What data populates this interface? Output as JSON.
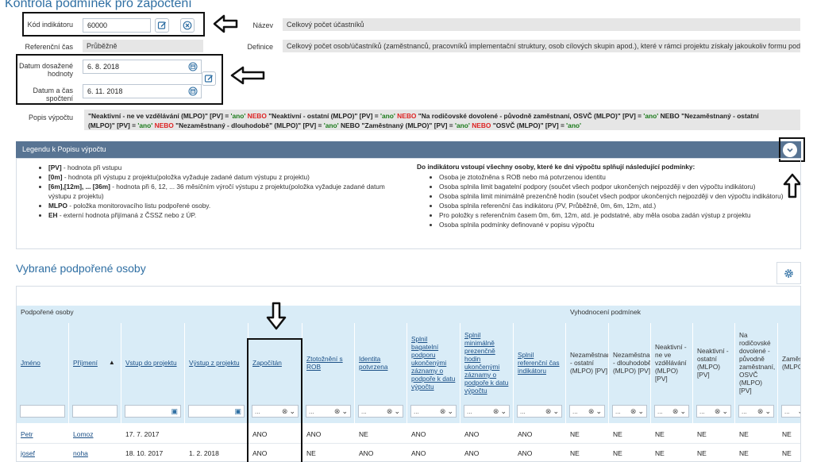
{
  "page_title": "Kontrola podmínek pro započtení",
  "kod_indikatoru": {
    "label": "Kód indikátoru",
    "value": "60000"
  },
  "nazev": {
    "label": "Název",
    "value": "Celkový počet účastníků"
  },
  "referencni_cas": {
    "label": "Referenční čas",
    "value": "Průběžně"
  },
  "definice": {
    "label": "Definice",
    "value": "Celkový počet osob/účastníků (zaměstnanců, pracovníků implementační struktury, osob cílových skupin apod.), které v rámci projektu získaly jakoukoliv formu podpo"
  },
  "datum_dosazene": {
    "label_line1": "Datum dosažené",
    "label_line2": "hodnoty",
    "value": "6. 8. 2018"
  },
  "datum_spocteni": {
    "label_line1": "Datum a čas",
    "label_line2": "spočtení",
    "value": "6. 11. 2018"
  },
  "popis_vypoctu": {
    "label": "Popis výpočtu",
    "p1": "\"Neaktivní - ne ve vzdělávání (MLPO)\" [PV] = ",
    "q": "'ano'",
    "or": " NEBO ",
    "p2": "\"Neaktivní - ostatní (MLPO)\" [PV] = ",
    "p3": "\"Na rodičovské dovolené - původně zaměstnaní, OSVČ (MLPO)\" [PV] = ",
    "p3b": " NEBO ",
    "p4": "\"Nezaměstnaný - ostatní",
    "p5": "(MLPO)\" [PV] = ",
    "p6": "\"Nezaměstnaný - dlouhodobě\" (MLPO)\" [PV] = ",
    "p6b": " NEBO ",
    "p7": "\"Zaměstnaný (MLPO)\" [PV] = ",
    "p8": "\"OSVČ (MLPO)\" [PV] = "
  },
  "legend": {
    "title": "Legendu k Popisu výpočtu",
    "left": [
      {
        "b": "[PV]",
        "t": " - hodnota při vstupu"
      },
      {
        "b": "[0m]",
        "t": " - hodnota při výstupu z projektu(položka vyžaduje zadané datum výstupu z projektu)"
      },
      {
        "b": "[6m],[12m], ... [36m]",
        "t": " - hodnota při 6, 12, ... 36 měsíčním výročí výstupu z projektu(položka vyžaduje zadané datum výstupu z projektu)"
      },
      {
        "b": "MLPO",
        "t": " - položka monitorovacího listu podpořené osoby."
      },
      {
        "b": "EH",
        "t": " - externí hodnota přijímaná z ČSSZ nebo z ÚP."
      }
    ],
    "right_title": "Do indikátoru vstoupí všechny osoby, které ke dni výpočtu splňují následující podmínky:",
    "right": [
      "Osoba je ztotožněna s ROB nebo má potvrzenou identitu",
      "Osoba splnila limit bagatelní podpory (součet všech podpor ukončených nejpozději v den výpočtu indikátoru)",
      "Osoba splnila limit minimálně prezenčně hodin (součet všech podpor ukončených nejpozději v den výpočtu indikátoru)",
      "Osoba splnila referenční čas indikátoru (PV, Průběžně, 0m, 6m, 12m, atd.)",
      "Pro položky s referenčním časem 0m, 6m, 12m, atd. je podstatné, aby měla osoba zadán výstup z projektu",
      "Osoba splnila podmínky definované v popisu výpočtu"
    ]
  },
  "section_title": "Vybrané podpořené osoby",
  "table": {
    "group_left": "Podpořené osoby",
    "group_right": "Vyhodnocení podmínek",
    "columns": [
      "Jméno",
      "Příjmení",
      "Vstup do projektu",
      "Výstup z projektu",
      "Započítán",
      "Ztotožnění s ROB",
      "Identita potvrzena",
      "Splnil bagatelní podporu ukončenými záznamy o podpoře k datu výpočtu",
      "Splnil minimálně prezenčně hodin ukončenými záznamy o podpoře k datu výpočtu",
      "Splnil referenční čas indikátoru",
      "Nezaměstnaný - ostatní (MLPO) [PV]",
      "Nezaměstnaný - dlouhodobě (MLPO) [PV]",
      "Neaktivní - ne ve vzdělávání (MLPO) [PV]",
      "Neaktivní - ostatní (MLPO) [PV]",
      "Na rodičovské dovolené - původně zaměstnaní, OSVČ (MLPO) [PV]",
      "Zaměstnaný (MLPO)"
    ],
    "sort_indicator": "▲",
    "filter_placeholder": "...",
    "rows": [
      [
        "Petr",
        "Lomoz",
        "17. 7. 2017",
        "",
        "ANO",
        "ANO",
        "NE",
        "ANO",
        "ANO",
        "ANO",
        "NE",
        "NE",
        "NE",
        "NE",
        "NE",
        "NE"
      ],
      [
        "josef",
        "noha",
        "18. 10. 2017",
        "1. 2. 2018",
        "ANO",
        "NE",
        "ANO",
        "ANO",
        "ANO",
        "ANO",
        "NE",
        "NE",
        "NE",
        "NE",
        "NE",
        "NE"
      ]
    ]
  },
  "colors": {
    "accent": "#2f6fa3",
    "legend_bar": "#587493",
    "header_bg": "#d9ecf7",
    "or_red": "#d22",
    "quote_green": "#1a7a1a"
  }
}
